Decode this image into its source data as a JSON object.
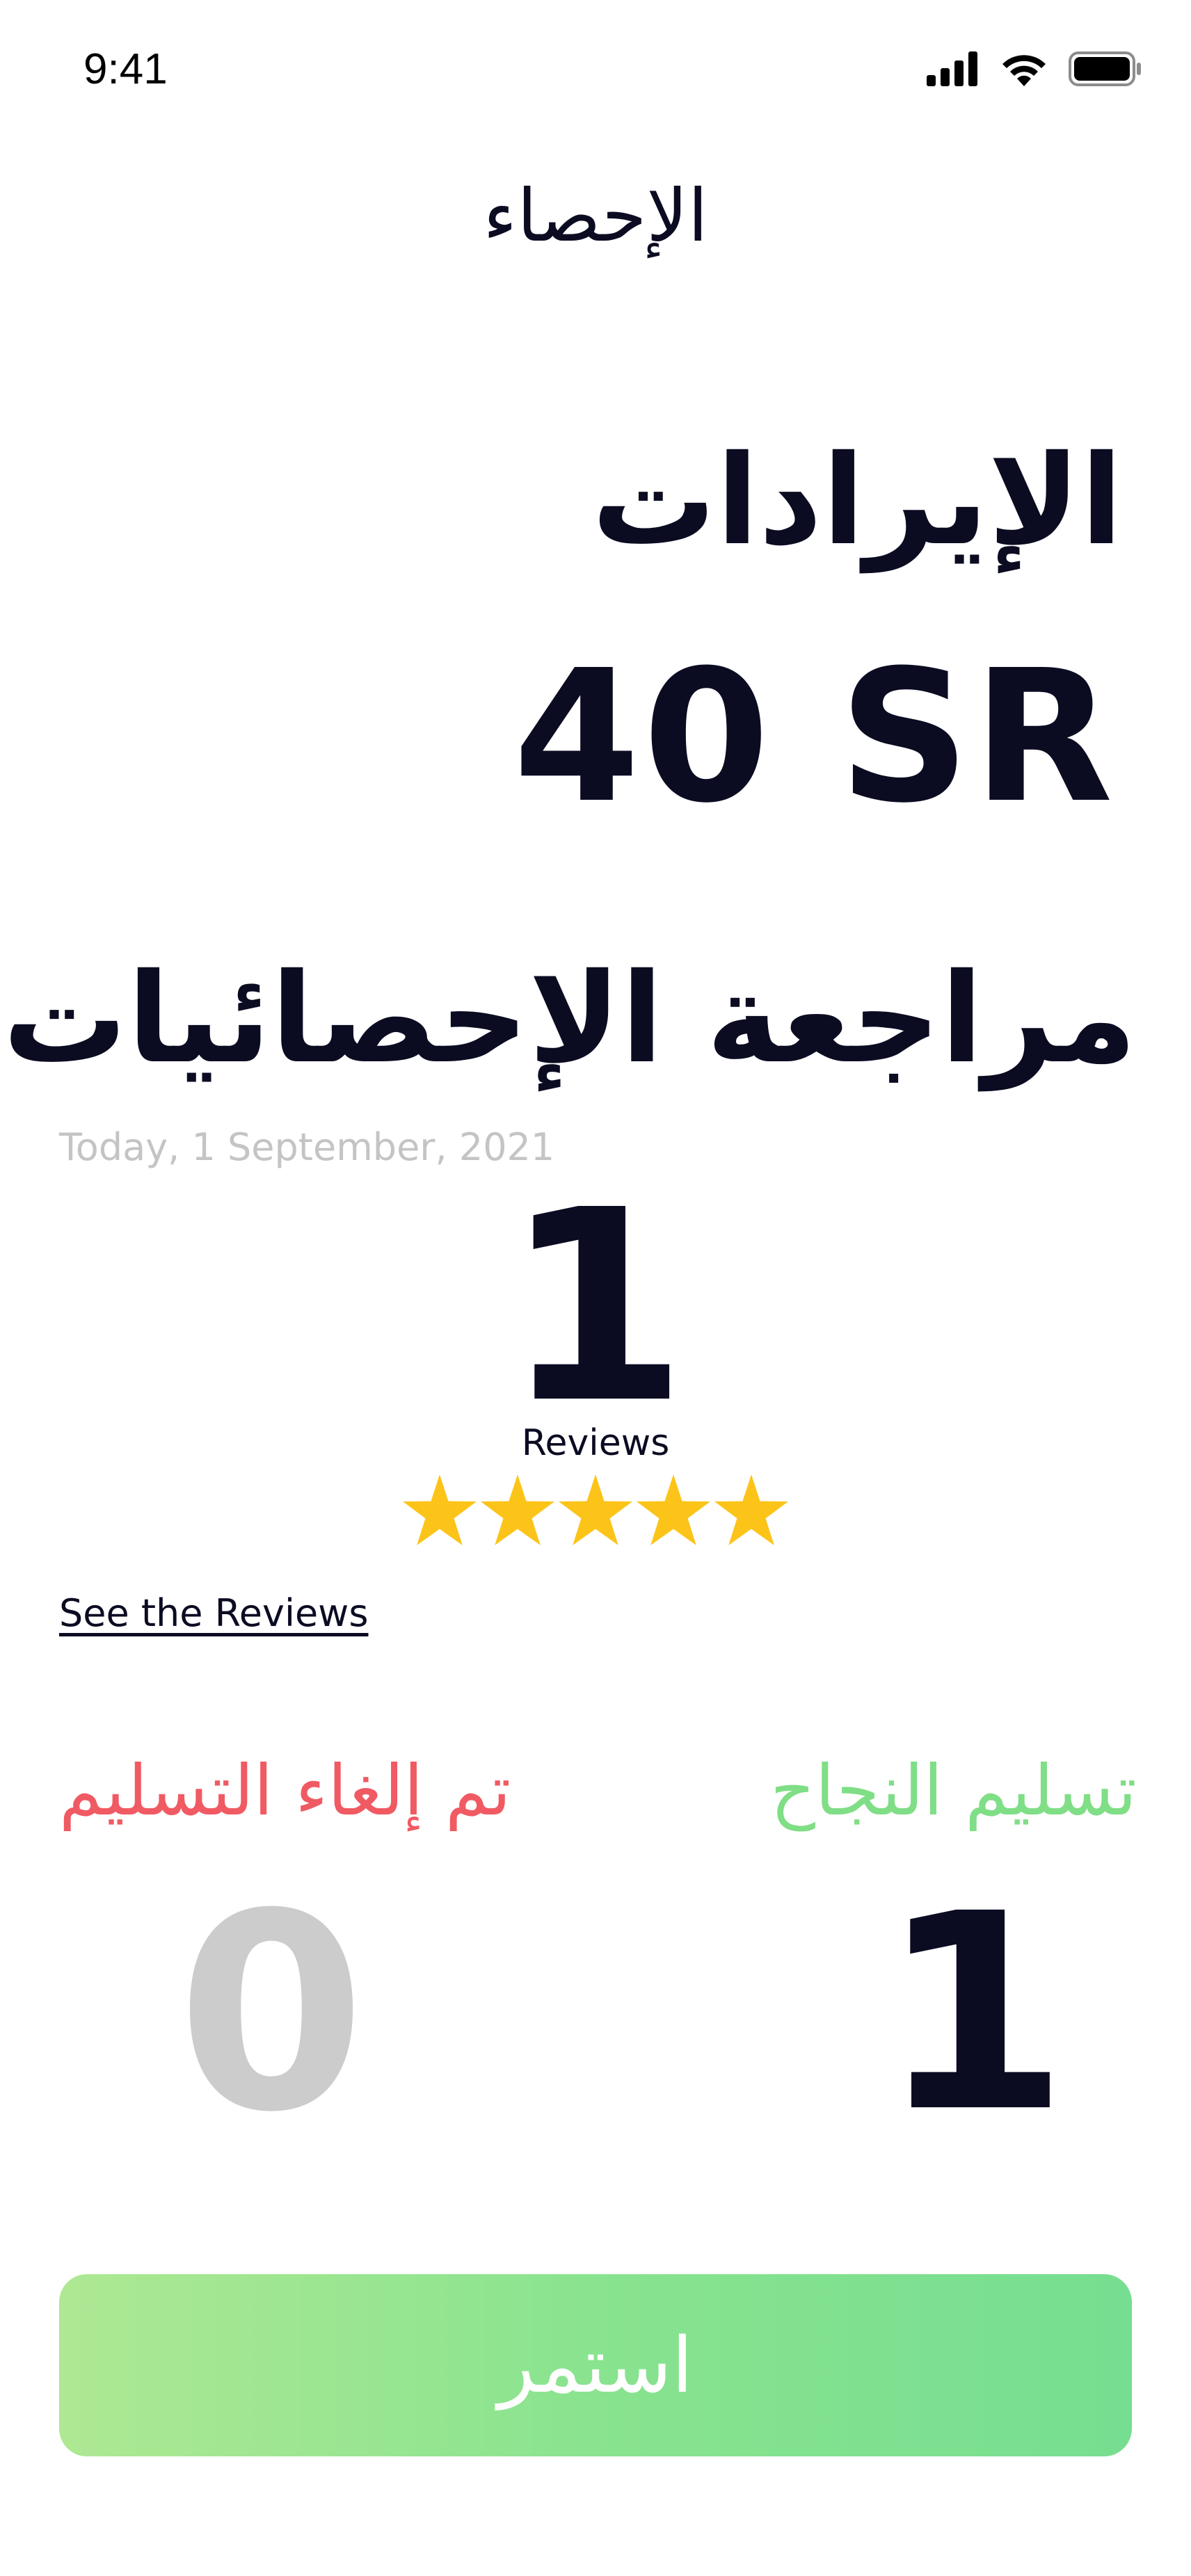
{
  "status_bar": {
    "time": "9:41"
  },
  "header": {
    "title": "الإحصاء"
  },
  "revenue": {
    "label": "الإيرادات",
    "value": "40 SR"
  },
  "statistics": {
    "title": "مراجعة الإحصائيات",
    "date": "Today, 1 September, 2021",
    "reviews_count": "1",
    "reviews_label": "Reviews",
    "rating": 5,
    "rating_max": 5,
    "see_reviews_link": "See the Reviews"
  },
  "deliveries": {
    "success_label": "تسليم النجاح",
    "success_count": "1",
    "cancelled_label": "تم إلغاء التسليم",
    "cancelled_count": "0"
  },
  "actions": {
    "continue_label": "استمر"
  },
  "colors": {
    "primary_text": "#0b0c22",
    "success": "#7fde86",
    "cancelled": "#f05a63",
    "muted": "#cccccc",
    "star": "#fcc419",
    "button_gradient_start": "#aee893",
    "button_gradient_end": "#76de90"
  },
  "icons": [
    "signal-icon",
    "wifi-icon",
    "battery-icon",
    "star-icon"
  ]
}
